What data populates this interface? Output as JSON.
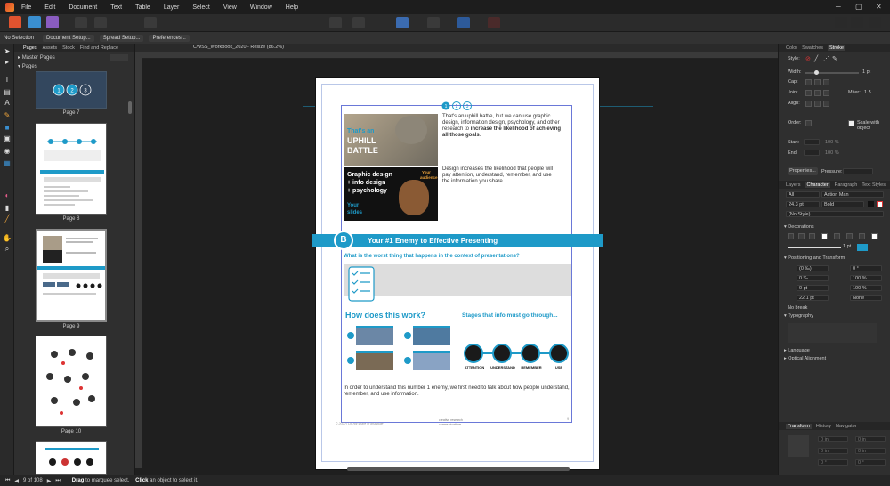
{
  "menu": [
    "File",
    "Edit",
    "Document",
    "Text",
    "Table",
    "Layer",
    "Select",
    "View",
    "Window",
    "Help"
  ],
  "context_bar": {
    "selection": "No Selection",
    "document_setup": "Document Setup...",
    "spread_setup": "Spread Setup...",
    "preferences": "Preferences..."
  },
  "pages_panel": {
    "tabs": [
      "Pages",
      "Assets",
      "Stock",
      "Find and Replace"
    ],
    "master_pages": "Master Pages",
    "pages": "Pages",
    "thumb_labels": [
      "Page 7",
      "Page 8",
      "Page 9",
      "Page 10"
    ]
  },
  "doc_tab": "CWSS_Workbook_2020 - Resize (86.2%)",
  "page": {
    "intro": "That's an uphill battle, but we can use graphic design, information design, psychology, and other research to ",
    "intro_bold": "increase the likelihood of achieving all those goals",
    "intro_end": ".",
    "para2": "Design increases the likelihood that people will pay attention, understand, remember, and use the information you share.",
    "img1": {
      "line1": "That's an",
      "line2": "UPHILL",
      "line3": "BATTLE"
    },
    "img2": {
      "l1": "Graphic design",
      "l2": "+ info design",
      "l3": "+ psychology",
      "your": "Your",
      "audience": "audience",
      "slides1": "Your",
      "slides2": "slides"
    },
    "band_letter": "B",
    "band_title": "Your #1 Enemy to Effective Presenting",
    "question": "What is the worst thing that happens in the context of presentations?",
    "how": "How does this work?",
    "stages": "Stages that info must go through...",
    "stage_labels": [
      "ATTENTION",
      "UNDERSTAND",
      "REMEMBER",
      "USE"
    ],
    "bottom_text": "In order to understand this number 1 enemy, we first need to talk about how people understand, remember, and use information.",
    "footer_left": "© 2020 | Do not share or distribute",
    "footer_logo1": "creative research",
    "footer_logo2": "communications",
    "page_num": "9"
  },
  "right_panel": {
    "top_tabs": [
      "Color",
      "Swatches",
      "Stroke"
    ],
    "style_label": "Style:",
    "width_label": "Width:",
    "width_value": "1 pt",
    "cap_label": "Cap:",
    "join_label": "Join:",
    "miter_label": "Miter:",
    "miter_value": "1.5",
    "align_label": "Align:",
    "order_label": "Order:",
    "scale_label": "Scale with object",
    "start_label": "Start:",
    "end_label": "End:",
    "start_pct": "100 %",
    "end_pct": "100 %",
    "properties_btn": "Properties...",
    "pressure_label": "Pressure:",
    "mid_tabs": [
      "Layers",
      "Character",
      "Paragraph",
      "Text Styles"
    ],
    "font_scope": "All",
    "font_name": "Action Man",
    "font_size": "24.3 pt",
    "font_weight": "Bold",
    "font_style": "(No Style)",
    "decorations": "Decorations",
    "decoration_size": "1 pt",
    "positioning": "Positioning and Transform",
    "pt_vals": [
      "(0 ‰)",
      "0 °",
      "0 ‰",
      "100 %",
      "0 pt",
      "100 %",
      "22.1 pt",
      "None"
    ],
    "no_break": "No break",
    "typography": "Typography",
    "language": "Language",
    "optical": "Optical Alignment",
    "bottom_tabs": [
      "Transform",
      "History",
      "Navigator"
    ],
    "transform_vals": [
      "0 in",
      "0 in",
      "0 in",
      "0 in",
      "0 °",
      "0 °"
    ]
  },
  "status": {
    "pages": "9 of 108",
    "drag": "Drag",
    "drag_msg": "to marquee select.",
    "click": "Click",
    "click_msg": "an object to select it."
  },
  "colors": {
    "accent": "#1e9ac8",
    "band": "#1e9ac8",
    "dark": "#1d1d1d"
  }
}
